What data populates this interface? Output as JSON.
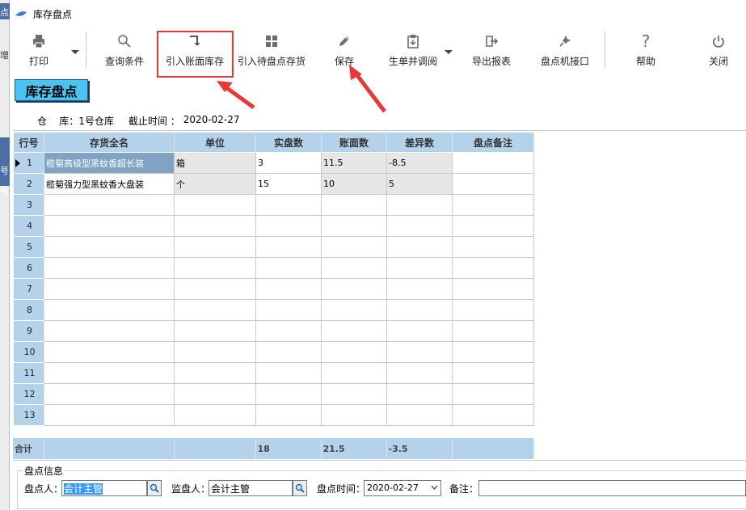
{
  "window": {
    "title": "库存盘点"
  },
  "background_strip": {
    "t1": "点",
    "t2": "增",
    "t3": "号",
    "t4": "号"
  },
  "toolbar": {
    "print": "打印",
    "query": "查询条件",
    "import_book": "引入账面库存",
    "import_pending": "引入待盘点存货",
    "save": "保存",
    "generate": "生单并调阅",
    "export": "导出报表",
    "device": "盘点机接口",
    "help": "帮助",
    "close": "关闭"
  },
  "section_title": "库存盘点",
  "meta": {
    "warehouse_label": "仓    库：",
    "warehouse_value": "1号仓库",
    "cutoff_label": "截止时间 ：",
    "cutoff_value": "2020-02-27"
  },
  "grid": {
    "columns": [
      "行号",
      "存货全名",
      "单位",
      "实盘数",
      "账面数",
      "差异数",
      "盘点备注"
    ],
    "rows": [
      {
        "no": "1",
        "name": "榄菊高级型黑蚊香超长装",
        "unit": "箱",
        "actual": "3",
        "book": "11.5",
        "diff": "-8.5",
        "note": ""
      },
      {
        "no": "2",
        "name": "榄菊强力型黑蚊香大盘装",
        "unit": "个",
        "actual": "15",
        "book": "10",
        "diff": "5",
        "note": ""
      },
      {
        "no": "3",
        "name": "",
        "unit": "",
        "actual": "",
        "book": "",
        "diff": "",
        "note": ""
      },
      {
        "no": "4",
        "name": "",
        "unit": "",
        "actual": "",
        "book": "",
        "diff": "",
        "note": ""
      },
      {
        "no": "5",
        "name": "",
        "unit": "",
        "actual": "",
        "book": "",
        "diff": "",
        "note": ""
      },
      {
        "no": "6",
        "name": "",
        "unit": "",
        "actual": "",
        "book": "",
        "diff": "",
        "note": ""
      },
      {
        "no": "7",
        "name": "",
        "unit": "",
        "actual": "",
        "book": "",
        "diff": "",
        "note": ""
      },
      {
        "no": "8",
        "name": "",
        "unit": "",
        "actual": "",
        "book": "",
        "diff": "",
        "note": ""
      },
      {
        "no": "9",
        "name": "",
        "unit": "",
        "actual": "",
        "book": "",
        "diff": "",
        "note": ""
      },
      {
        "no": "10",
        "name": "",
        "unit": "",
        "actual": "",
        "book": "",
        "diff": "",
        "note": ""
      },
      {
        "no": "11",
        "name": "",
        "unit": "",
        "actual": "",
        "book": "",
        "diff": "",
        "note": ""
      },
      {
        "no": "12",
        "name": "",
        "unit": "",
        "actual": "",
        "book": "",
        "diff": "",
        "note": ""
      },
      {
        "no": "13",
        "name": "",
        "unit": "",
        "actual": "",
        "book": "",
        "diff": "",
        "note": ""
      }
    ],
    "total": {
      "label": "合计",
      "actual": "18",
      "book": "21.5",
      "diff": "-3.5"
    }
  },
  "info": {
    "legend": "盘点信息",
    "counter_label": "盘点人：",
    "counter_value": "会计主管",
    "supervisor_label": "监盘人：",
    "supervisor_value": "会计主管",
    "time_label": "盘点时间：",
    "time_value": "2020-02-27",
    "note_label": "备注：",
    "note_value": ""
  },
  "colors": {
    "header_blue": "#b4d2ea",
    "selected_cell": "#7fa2c5",
    "title_badge": "#4ac3f1",
    "annotation_red": "#e53935"
  }
}
